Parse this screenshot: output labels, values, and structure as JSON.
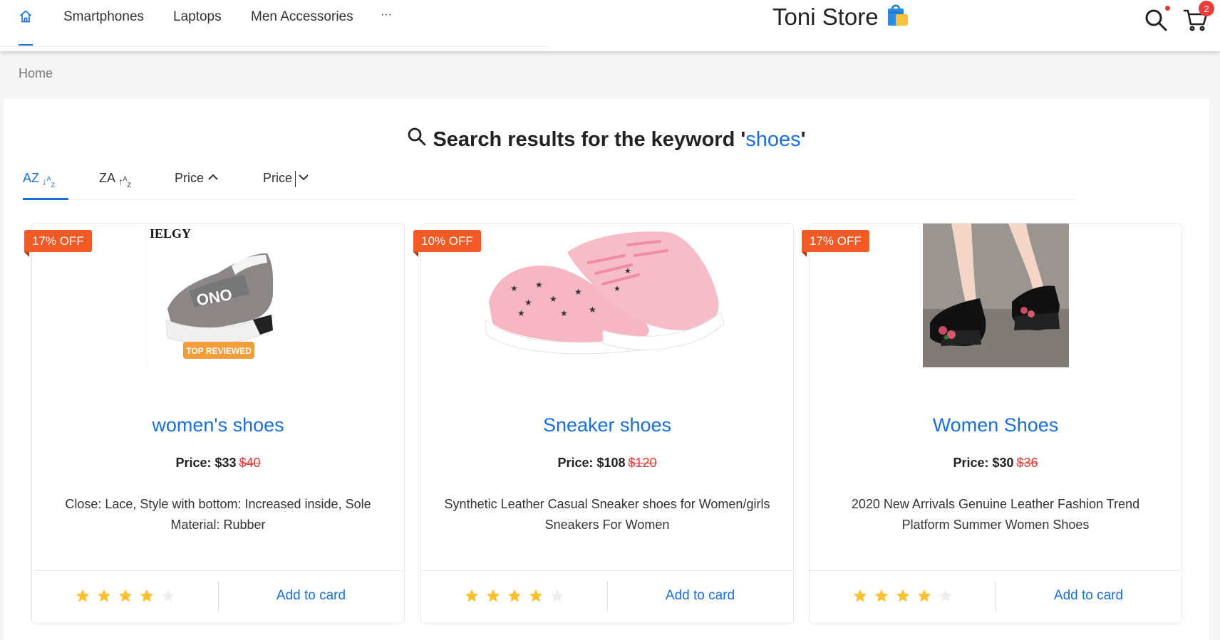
{
  "header": {
    "nav": [
      "Smartphones",
      "Laptops",
      "Men Accessories",
      "···"
    ],
    "brand": "Toni Store",
    "cart_count": "2"
  },
  "breadcrumb": "Home",
  "search": {
    "prefix": "Search results for the keyword '",
    "keyword": "shoes",
    "suffix": "'"
  },
  "sort": [
    "AZ",
    "ZA",
    "Price",
    "Price"
  ],
  "products": [
    {
      "discount": "17% OFF",
      "name": "women's shoes",
      "price_label": "Price: $33",
      "old_price": "$40",
      "description": "Close: Lace, Style with bottom: Increased inside, Sole Material: Rubber",
      "rating": 4,
      "image_text": "IELGY",
      "badge_text": "TOP REVIEWED",
      "add_label": "Add to card"
    },
    {
      "discount": "10% OFF",
      "name": "Sneaker shoes",
      "price_label": "Price: $108",
      "old_price": "$120",
      "description": "Synthetic Leather Casual Sneaker shoes for Women/girls Sneakers For Women",
      "rating": 4,
      "add_label": "Add to card"
    },
    {
      "discount": "17% OFF",
      "name": "Women Shoes",
      "price_label": "Price: $30",
      "old_price": "$36",
      "description": "2020 New Arrivals Genuine Leather Fashion Trend Platform Summer Women Shoes",
      "rating": 4,
      "add_label": "Add to card"
    }
  ],
  "colors": {
    "accent": "#1a6fe0",
    "discount": "#f15a24",
    "old_price": "#e53935",
    "star": "#fbc02d"
  }
}
